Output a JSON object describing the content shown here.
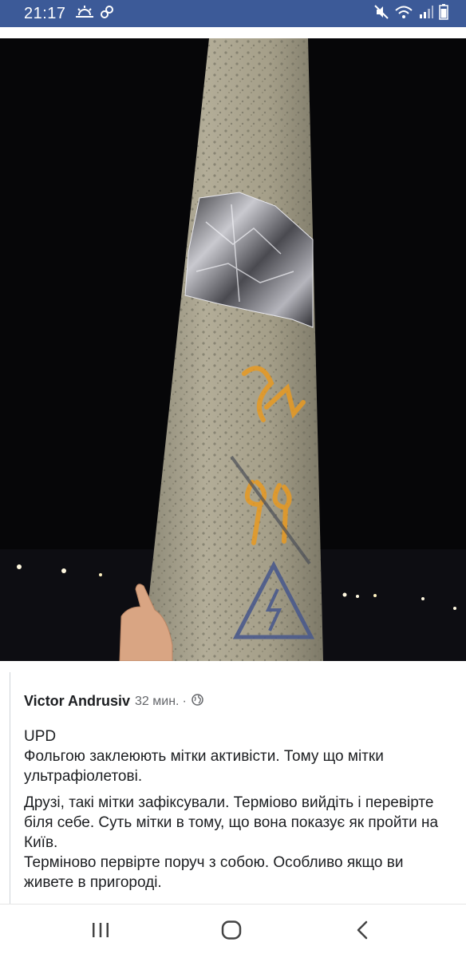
{
  "status_bar": {
    "time": "21:17",
    "icons": [
      "weather-icon",
      "link-icon",
      "mute-icon",
      "wifi-icon",
      "signal-icon",
      "battery-icon"
    ]
  },
  "photo": {
    "subject": "concrete-pole-with-foil-and-markings",
    "marking_color": "#e89a22"
  },
  "post": {
    "author": "Victor Andrusiv",
    "time": "32 мин.",
    "separator": "·",
    "privacy_icon": "globe-icon",
    "line1": "UPD",
    "line2": "Фольгою заклеюють мітки активісти. Тому що мітки ультрафіолетові.",
    "line3": "Друзі, такі мітки зафіксували. Терміово вийдіть і перевірте біля себе. Суть мітки в тому, що вона показує як пройти на Київ.",
    "line4": "Терміново первірте поруч з собою. Особливо якщо ви живете в пригороді."
  },
  "nav_bar": {
    "icons": [
      "recents-icon",
      "home-icon",
      "back-icon"
    ]
  },
  "colors": {
    "status_bar": "#3c5a98",
    "text_primary": "#1c1e21",
    "text_secondary": "#65676b"
  }
}
